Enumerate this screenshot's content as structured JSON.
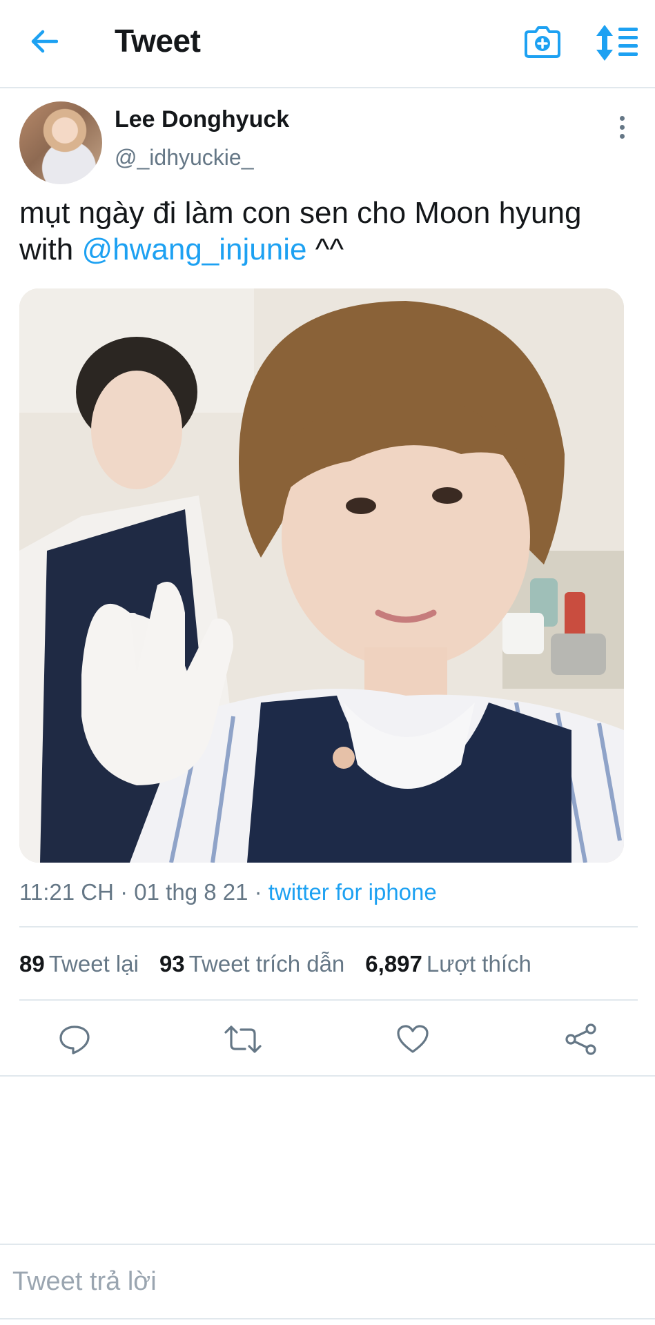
{
  "header": {
    "title": "Tweet",
    "back_icon": "back-arrow-icon",
    "camera_icon": "camera-add-icon",
    "sort_icon": "sort-icon"
  },
  "tweet": {
    "author_name": "Lee Donghyuck",
    "author_handle": "@_idhyuckie_",
    "text_before": "mụt ngày đi làm con sen cho Moon hyung with ",
    "mention": "@hwang_injunie",
    "text_after": " ^^",
    "time": "11:21 CH",
    "date": "01 thg 8 21",
    "source": "twitter for iphone"
  },
  "stats": {
    "retweets_count": "89",
    "retweets_label": "Tweet lại",
    "quotes_count": "93",
    "quotes_label": "Tweet trích dẫn",
    "likes_count": "6,897",
    "likes_label": "Lượt thích"
  },
  "actions": {
    "reply_icon": "reply-icon",
    "retweet_icon": "retweet-icon",
    "like_icon": "heart-icon",
    "share_icon": "share-icon"
  },
  "reply_bar": {
    "placeholder": "Tweet trả lời"
  },
  "colors": {
    "accent": "#1da1f2",
    "secondary_text": "#657786",
    "divider": "#e1e8ed"
  }
}
